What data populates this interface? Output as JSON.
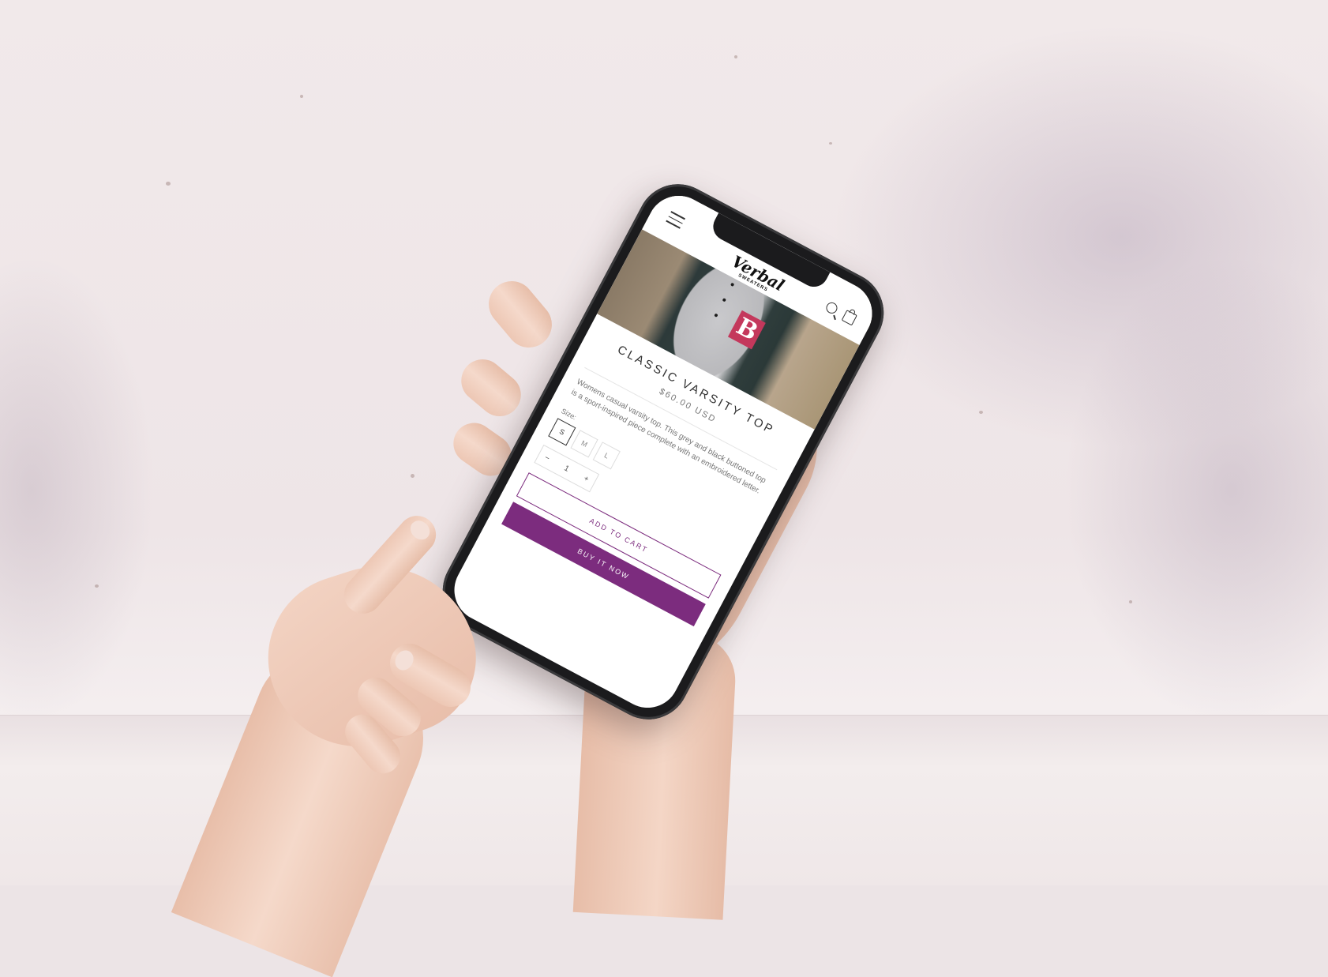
{
  "app": {
    "brand_script": "Verbal",
    "brand_sub": "SWEATERS"
  },
  "product": {
    "letter": "B",
    "title": "Classic Varsity Top",
    "price": "$60.00 USD",
    "description": "Womens casual varsity top. This grey and black buttoned top is a sport-inspired piece complete with an embroidered letter.",
    "size_label": "Size:",
    "sizes": [
      "S",
      "M",
      "L"
    ],
    "selected_size": "S",
    "quantity": "1",
    "qty_minus": "−",
    "qty_plus": "+"
  },
  "actions": {
    "add_to_cart": "ADD TO CART",
    "buy_now": "BUY IT NOW"
  },
  "colors": {
    "accent": "#7c2c7e",
    "patch": "#c4385c"
  },
  "icons": [
    "menu-icon",
    "search-icon",
    "bag-icon"
  ]
}
